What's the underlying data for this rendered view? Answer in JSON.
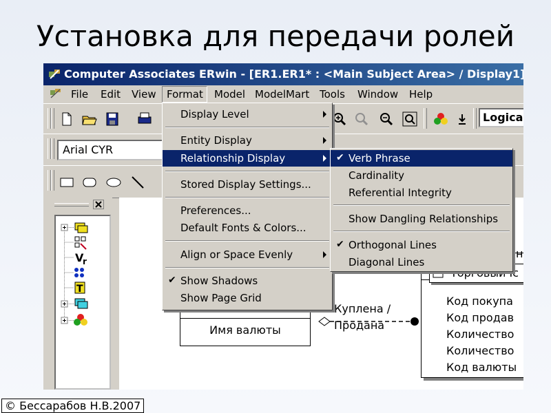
{
  "slide": {
    "title": "Установка для передачи ролей",
    "copyright": "© Бессарабов Н.В.2007"
  },
  "window": {
    "title": "Computer Associates ERwin - [ER1.ER1* : <Main Subject Area> / Display1]",
    "icon": "erwin-app-icon"
  },
  "menubar": {
    "items": [
      "File",
      "Edit",
      "View",
      "Format",
      "Model",
      "ModelMart",
      "Tools",
      "Window",
      "Help"
    ]
  },
  "toolbar": {
    "font_combo_value": "Arial CYR",
    "view_combo_value": "Logica"
  },
  "format_menu": {
    "items": [
      {
        "label": "Display Level",
        "submenu": true
      },
      {
        "label": "Entity Display",
        "submenu": true
      },
      {
        "label": "Relationship Display",
        "submenu": true,
        "highlighted": true
      },
      {
        "label": "Stored Display Settings...",
        "submenu": false
      },
      {
        "label": "Preferences...",
        "submenu": false
      },
      {
        "label": "Default Fonts & Colors...",
        "submenu": false
      },
      {
        "label": "Align or Space Evenly",
        "submenu": true
      },
      {
        "label": "Show Shadows",
        "checked": true
      },
      {
        "label": "Show Page Grid",
        "checked": false
      }
    ]
  },
  "relationship_submenu": {
    "items": [
      {
        "label": "Verb Phrase",
        "checked": true,
        "highlighted": true
      },
      {
        "label": "Cardinality",
        "checked": false
      },
      {
        "label": "Referential Integrity",
        "checked": false
      },
      {
        "label": "Show Dangling Relationships",
        "checked": false
      },
      {
        "label": "Orthogonal Lines",
        "checked": true
      },
      {
        "label": "Diagonal Lines",
        "checked": false
      }
    ]
  },
  "diagram": {
    "entity_left_attr": "Имя валюты",
    "relationship_label_1": "Куплена /",
    "relationship_label_2": "Продана",
    "entity_right_header_partial_1": "нк",
    "entity_right_header_partial_2": "Торговый Ic",
    "entity_right_attrs": [
      "Код покупа",
      "Код продав",
      "Количество",
      "Количество",
      "Код валюты"
    ]
  },
  "colors": {
    "titlebar_start": "#0a246a",
    "titlebar_end": "#3a6ea5",
    "menu_highlight": "#0a246a",
    "window_bg": "#d4d0c8"
  }
}
